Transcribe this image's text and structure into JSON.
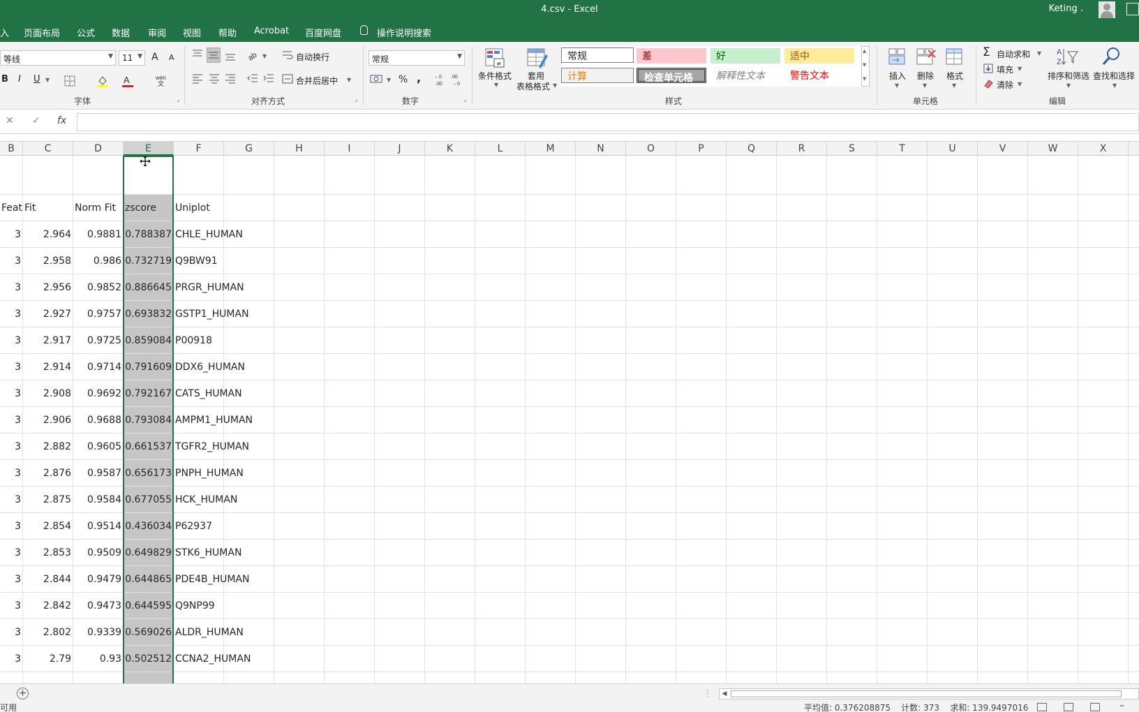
{
  "window": {
    "title": "4.csv  -  Excel",
    "user": "Keting ."
  },
  "menu": {
    "tabs": [
      "入",
      "页面布局",
      "公式",
      "数据",
      "审阅",
      "视图",
      "帮助",
      "Acrobat",
      "百度网盘"
    ],
    "search": "操作说明搜索"
  },
  "ribbon": {
    "font": {
      "name": "等线",
      "size": "11",
      "grow": "A",
      "shrink": "A",
      "bold": "B",
      "italic": "I",
      "underline": "U",
      "group_label": "字体"
    },
    "alignment": {
      "wrap_text": "自动换行",
      "merge_center": "合并后居中",
      "group_label": "对齐方式"
    },
    "number": {
      "format": "常规",
      "percent": "%",
      "comma": ",",
      "group_label": "数字"
    },
    "styles": {
      "conditional_format": "条件格式",
      "table_format_1": "套用",
      "table_format_2": "表格格式",
      "cells": [
        {
          "label": "常规"
        },
        {
          "label": "差"
        },
        {
          "label": "好"
        },
        {
          "label": "适中"
        },
        {
          "label": "计算"
        },
        {
          "label": "检查单元格"
        },
        {
          "label": "解释性文本"
        },
        {
          "label": "警告文本"
        }
      ],
      "group_label": "样式"
    },
    "cells": {
      "insert": "插入",
      "delete": "删除",
      "format": "格式",
      "group_label": "单元格"
    },
    "editing": {
      "autosum": "自动求和",
      "fill": "填充",
      "clear": "清除",
      "sort_filter": "排序和筛选",
      "find_select": "查找和选择",
      "group_label": "编辑"
    }
  },
  "formula_bar": {
    "cancel": "✕",
    "enter": "✓",
    "fx": "fx",
    "value": ""
  },
  "columns": [
    "B",
    "C",
    "D",
    "E",
    "F",
    "G",
    "H",
    "I",
    "J",
    "K",
    "L",
    "M",
    "N",
    "O",
    "P",
    "Q",
    "R",
    "S",
    "T",
    "U",
    "V",
    "W",
    "X"
  ],
  "header_row": [
    "Featu",
    "Fit",
    "Norm Fit",
    "zscore",
    "Uniplot"
  ],
  "rows": [
    [
      "3",
      "2.964",
      "0.9881",
      "0.788387",
      "CHLE_HUMAN"
    ],
    [
      "3",
      "2.958",
      "0.986",
      "0.732719",
      "Q9BW91"
    ],
    [
      "3",
      "2.956",
      "0.9852",
      "0.886645",
      "PRGR_HUMAN"
    ],
    [
      "3",
      "2.927",
      "0.9757",
      "0.693832",
      "GSTP1_HUMAN"
    ],
    [
      "3",
      "2.917",
      "0.9725",
      "0.859084",
      "P00918"
    ],
    [
      "3",
      "2.914",
      "0.9714",
      "0.791609",
      "DDX6_HUMAN"
    ],
    [
      "3",
      "2.908",
      "0.9692",
      "0.792167",
      "CATS_HUMAN"
    ],
    [
      "3",
      "2.906",
      "0.9688",
      "0.793084",
      "AMPM1_HUMAN"
    ],
    [
      "3",
      "2.882",
      "0.9605",
      "0.661537",
      "TGFR2_HUMAN"
    ],
    [
      "3",
      "2.876",
      "0.9587",
      "0.656173",
      "PNPH_HUMAN"
    ],
    [
      "3",
      "2.875",
      "0.9584",
      "0.677055",
      "HCK_HUMAN"
    ],
    [
      "3",
      "2.854",
      "0.9514",
      "0.436034",
      "P62937"
    ],
    [
      "3",
      "2.853",
      "0.9509",
      "0.649829",
      "STK6_HUMAN"
    ],
    [
      "3",
      "2.844",
      "0.9479",
      "0.644865",
      "PDE4B_HUMAN"
    ],
    [
      "3",
      "2.842",
      "0.9473",
      "0.644595",
      "Q9NP99"
    ],
    [
      "3",
      "2.802",
      "0.9339",
      "0.569026",
      "ALDR_HUMAN"
    ],
    [
      "3",
      "2.79",
      "0.93",
      "0.502512",
      "CCNA2_HUMAN"
    ]
  ],
  "sheetbar": {
    "add": "+"
  },
  "status": {
    "ready": "可用",
    "average": "平均值: 0.376208875",
    "count": "计数: 373",
    "sum": "求和: 139.9497016"
  }
}
